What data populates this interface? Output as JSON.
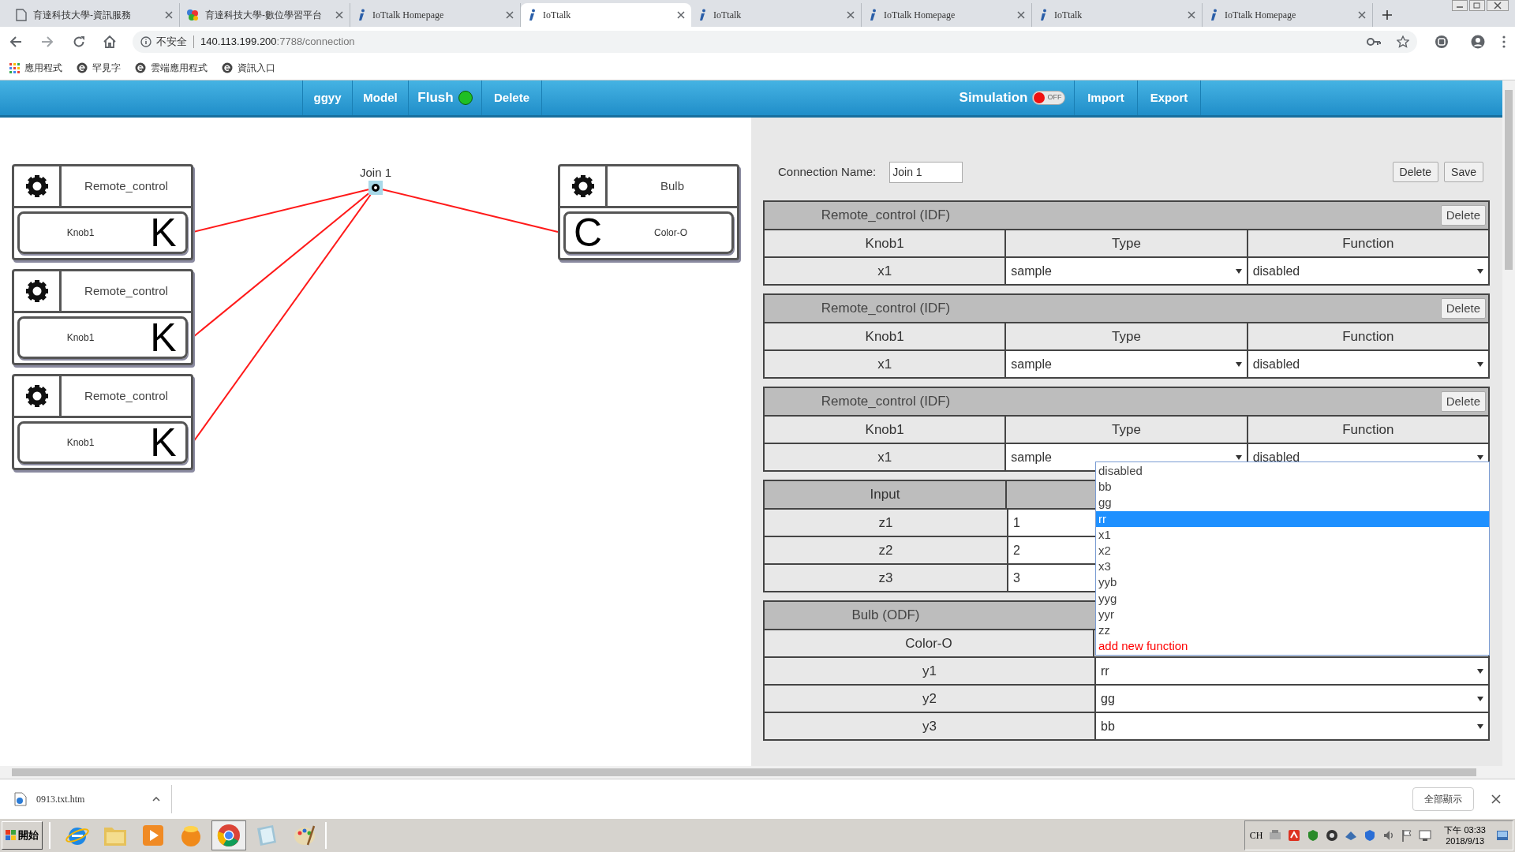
{
  "browser": {
    "tabs": [
      {
        "title": "育達科技大學-資訊服務",
        "kind": "page",
        "selected": false
      },
      {
        "title": "育達科技大學-數位學習平台",
        "kind": "colorful",
        "selected": false
      },
      {
        "title": "IoTtalk Homepage",
        "kind": "info",
        "selected": false
      },
      {
        "title": "IoTtalk",
        "kind": "info",
        "selected": true
      },
      {
        "title": "IoTtalk",
        "kind": "info",
        "selected": false
      },
      {
        "title": "IoTtalk Homepage",
        "kind": "info",
        "selected": false
      },
      {
        "title": "IoTtalk",
        "kind": "info",
        "selected": false
      },
      {
        "title": "IoTtalk Homepage",
        "kind": "info",
        "selected": false
      }
    ],
    "address": {
      "security": "不安全",
      "host": "140.113.199.200",
      "path": ":7788/connection"
    },
    "bookmarks": [
      {
        "label": "應用程式",
        "kind": "apps"
      },
      {
        "label": "罕見字",
        "kind": "site"
      },
      {
        "label": "雲端應用程式",
        "kind": "site"
      },
      {
        "label": "資訊入口",
        "kind": "site"
      }
    ]
  },
  "nav": {
    "left": [
      {
        "label": "ggyy",
        "kind": "plain"
      },
      {
        "label": "Model",
        "kind": "plain"
      },
      {
        "label": "Flush",
        "kind": "flush",
        "on": true
      },
      {
        "label": "Delete",
        "kind": "plain"
      }
    ],
    "simulation": {
      "label": "Simulation",
      "on": false,
      "switch_text": "OFF"
    },
    "right": [
      {
        "label": "Import"
      },
      {
        "label": "Export"
      }
    ]
  },
  "canvas": {
    "devices": [
      {
        "name": "Remote_control",
        "feature": "Knob1",
        "letter": "K",
        "kind": "input"
      },
      {
        "name": "Remote_control",
        "feature": "Knob1",
        "letter": "K",
        "kind": "input"
      },
      {
        "name": "Remote_control",
        "feature": "Knob1",
        "letter": "K",
        "kind": "input"
      },
      {
        "name": "Bulb",
        "feature": "Color-O",
        "letter": "C",
        "kind": "output"
      }
    ],
    "join": {
      "label": "Join 1"
    }
  },
  "panel": {
    "connection_name_label": "Connection Name:",
    "connection_name": "Join 1",
    "buttons": [
      "Delete",
      "Save"
    ],
    "idf_tables": [
      {
        "title": "Remote_control (IDF)",
        "delete": "Delete",
        "columns": [
          "Knob1",
          "Type",
          "Function"
        ],
        "rows": [
          {
            "name": "x1",
            "type": "sample",
            "function": "disabled"
          }
        ]
      },
      {
        "title": "Remote_control (IDF)",
        "delete": "Delete",
        "columns": [
          "Knob1",
          "Type",
          "Function"
        ],
        "rows": [
          {
            "name": "x1",
            "type": "sample",
            "function": "disabled"
          }
        ]
      },
      {
        "title": "Remote_control (IDF)",
        "delete": "Delete",
        "columns": [
          "Knob1",
          "Type",
          "Function"
        ],
        "rows": [
          {
            "name": "x1",
            "type": "sample",
            "function": "disabled"
          }
        ]
      }
    ],
    "input_table": {
      "header": "Input",
      "rows": [
        {
          "name": "z1",
          "value": "1"
        },
        {
          "name": "z2",
          "value": "2"
        },
        {
          "name": "z3",
          "value": "3"
        }
      ]
    },
    "odf_table": {
      "title": "Bulb (ODF)",
      "feature": "Color-O",
      "rows": [
        {
          "name": "y1",
          "function": "rr"
        },
        {
          "name": "y2",
          "function": "gg"
        },
        {
          "name": "y3",
          "function": "bb"
        }
      ]
    },
    "dropdown": {
      "options": [
        {
          "label": "disabled",
          "kind": "option",
          "selected": false
        },
        {
          "label": "bb",
          "kind": "option",
          "selected": false
        },
        {
          "label": "gg",
          "kind": "option",
          "selected": false
        },
        {
          "label": "rr",
          "kind": "option",
          "selected": true
        },
        {
          "label": "x1",
          "kind": "option",
          "selected": false
        },
        {
          "label": "x2",
          "kind": "option",
          "selected": false
        },
        {
          "label": "x3",
          "kind": "option",
          "selected": false
        },
        {
          "label": "yyb",
          "kind": "option",
          "selected": false
        },
        {
          "label": "yyg",
          "kind": "option",
          "selected": false
        },
        {
          "label": "yyr",
          "kind": "option",
          "selected": false
        },
        {
          "label": "zz",
          "kind": "option",
          "selected": false
        },
        {
          "label": "add new function",
          "kind": "add",
          "selected": false
        }
      ]
    }
  },
  "downloads": {
    "file": "0913.txt.htm",
    "show_all": "全部顯示"
  },
  "taskbar": {
    "start": "開始",
    "apps": [
      {
        "kind": "browser",
        "selected": false
      },
      {
        "kind": "folder",
        "selected": false
      },
      {
        "kind": "media",
        "selected": false
      },
      {
        "kind": "ball",
        "selected": false
      },
      {
        "kind": "chrome",
        "selected": true
      },
      {
        "kind": "notebook",
        "selected": false
      },
      {
        "kind": "paint",
        "selected": false
      }
    ],
    "lang": "CH",
    "time": "下午 03:33",
    "date": "2018/9/13"
  }
}
